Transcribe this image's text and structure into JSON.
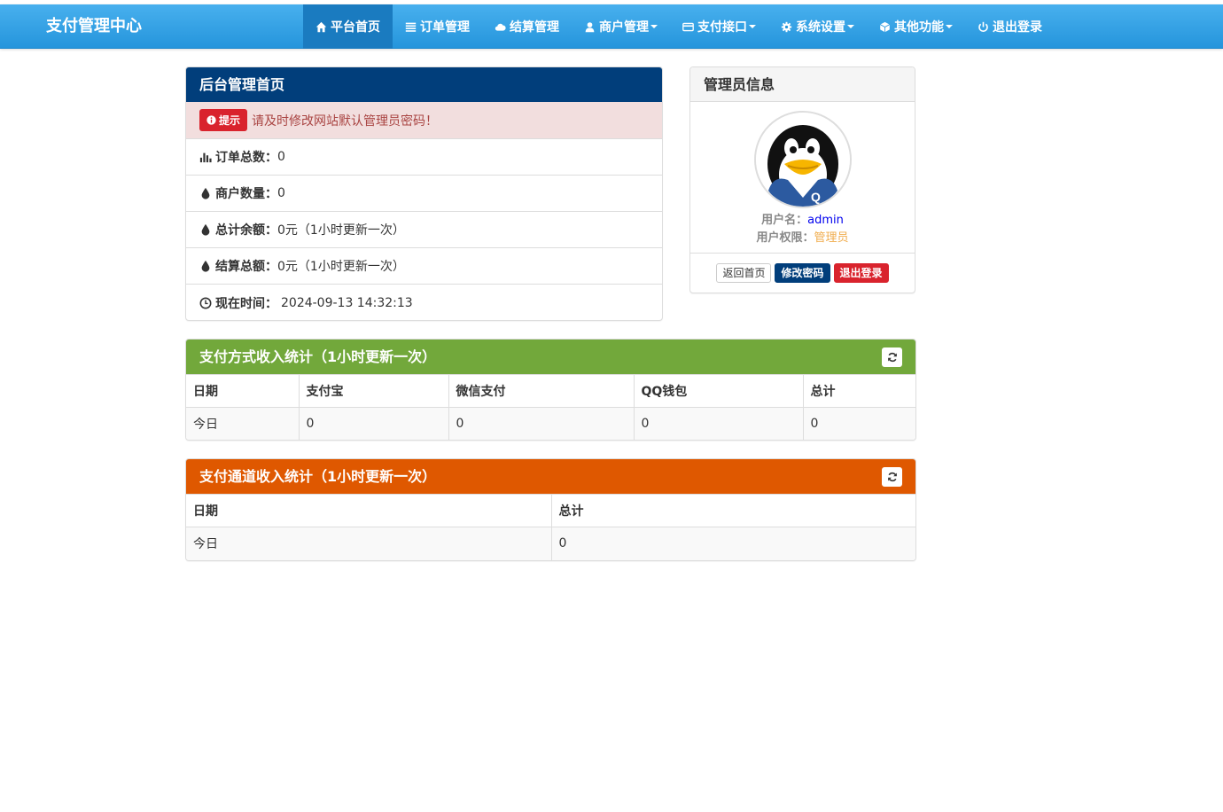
{
  "navbar": {
    "brand": "支付管理中心",
    "items": [
      {
        "label": "平台首页",
        "icon": "home-icon",
        "active": true,
        "dropdown": false
      },
      {
        "label": "订单管理",
        "icon": "list-icon",
        "active": false,
        "dropdown": false
      },
      {
        "label": "结算管理",
        "icon": "cloud-icon",
        "active": false,
        "dropdown": false
      },
      {
        "label": "商户管理",
        "icon": "user-icon",
        "active": false,
        "dropdown": true
      },
      {
        "label": "支付接口",
        "icon": "credit-card-icon",
        "active": false,
        "dropdown": true
      },
      {
        "label": "系统设置",
        "icon": "gear-icon",
        "active": false,
        "dropdown": true
      },
      {
        "label": "其他功能",
        "icon": "cube-icon",
        "active": false,
        "dropdown": true
      },
      {
        "label": "退出登录",
        "icon": "power-icon",
        "active": false,
        "dropdown": false
      }
    ]
  },
  "home_panel": {
    "title": "后台管理首页",
    "alert_badge": "提示",
    "alert_text": "请及时修改网站默认管理员密码！",
    "order_total_label": "订单总数：",
    "order_total_value": "0",
    "merchant_count_label": "商户数量：",
    "merchant_count_value": "0",
    "balance_label": "总计余额：",
    "balance_value": "0元（1小时更新一次）",
    "settlement_label": "结算总额：",
    "settlement_value": "0元（1小时更新一次）",
    "time_label": "现在时间：",
    "time_value": "2024-09-13 14:32:13"
  },
  "admin_panel": {
    "title": "管理员信息",
    "username_label": "用户名：",
    "username_value": "admin",
    "role_label": "用户权限：",
    "role_value": "管理员",
    "btn_home": "返回首页",
    "btn_password": "修改密码",
    "btn_logout": "退出登录"
  },
  "method_stats": {
    "title": "支付方式收入统计（1小时更新一次）",
    "columns": [
      "日期",
      "支付宝",
      "微信支付",
      "QQ钱包",
      "总计"
    ],
    "rows": [
      [
        "今日",
        "0",
        "0",
        "0",
        "0"
      ]
    ]
  },
  "channel_stats": {
    "title": "支付通道收入统计（1小时更新一次）",
    "columns": [
      "日期",
      "总计"
    ],
    "rows": [
      [
        "今日",
        "0"
      ]
    ]
  },
  "colors": {
    "navbar": "#2d9fe6",
    "home_heading": "#013e7b",
    "method_heading": "#72a83b",
    "channel_heading": "#df5800",
    "danger": "#d9232d"
  }
}
